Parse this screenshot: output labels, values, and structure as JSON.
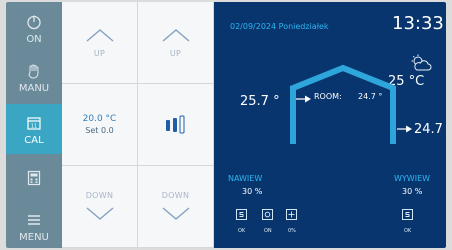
{
  "nav": {
    "items": [
      {
        "label": "ON",
        "icon": "power-icon"
      },
      {
        "label": "MANU",
        "icon": "hand-icon"
      },
      {
        "label": "CAL",
        "icon": "calendar-icon"
      },
      {
        "label": "",
        "icon": "calculator-icon"
      },
      {
        "label": "MENU",
        "icon": "hamburger-icon"
      }
    ],
    "active": "CAL"
  },
  "controls": {
    "up_label_1": "UP",
    "up_label_2": "UP",
    "down_label_1": "DOWN",
    "down_label_2": "DOWN",
    "setpoint_value": "20.0 °C",
    "setpoint_sub": "Set 0.0"
  },
  "status": {
    "date": "02/09/2024  Poniedziałek",
    "time": "13:33",
    "outside_temp": "25 °C",
    "inside_temp": "25.7 °",
    "room_label": "ROOM:",
    "room_value": "24.7 °",
    "supply_temp": "24.7",
    "nawiew_label": "NAWIEW",
    "nawiew_value": "30 %",
    "wywiew_label": "WYWIEW",
    "wywiew_value": "30 %",
    "icon_labels": {
      "ok": "OK",
      "on": "ON",
      "pct": "0%",
      "ok2": "OK"
    }
  },
  "colors": {
    "panel_bg": "#08356e",
    "accent": "#2fb5f0",
    "nav_bg": "#6b8a99",
    "nav_active": "#3aa6c4"
  }
}
